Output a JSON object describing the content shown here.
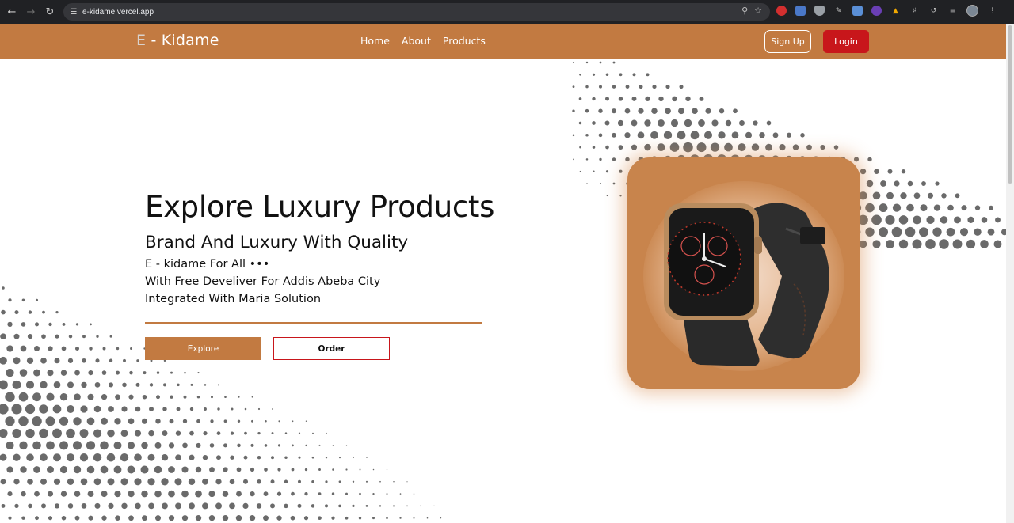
{
  "browser": {
    "url": "e-kidame.vercel.app"
  },
  "header": {
    "logo_prefix": "E",
    "logo_rest": " - Kidame",
    "nav": [
      "Home",
      "About",
      "Products"
    ],
    "signup_label": "Sign Up",
    "login_label": "Login",
    "colors": {
      "brand": "#c27a41",
      "login": "#c8161b"
    }
  },
  "hero": {
    "title": "Explore Luxury Products",
    "subtitle": "Brand And Luxury With Quality",
    "line1": "E - kidame For All •••",
    "line2": "With Free Develiver For Addis Abeba City",
    "line3": "Integrated With Maria Solution",
    "explore_label": "Explore",
    "order_label": "Order"
  },
  "product": {
    "image": "smartwatch-icon"
  }
}
